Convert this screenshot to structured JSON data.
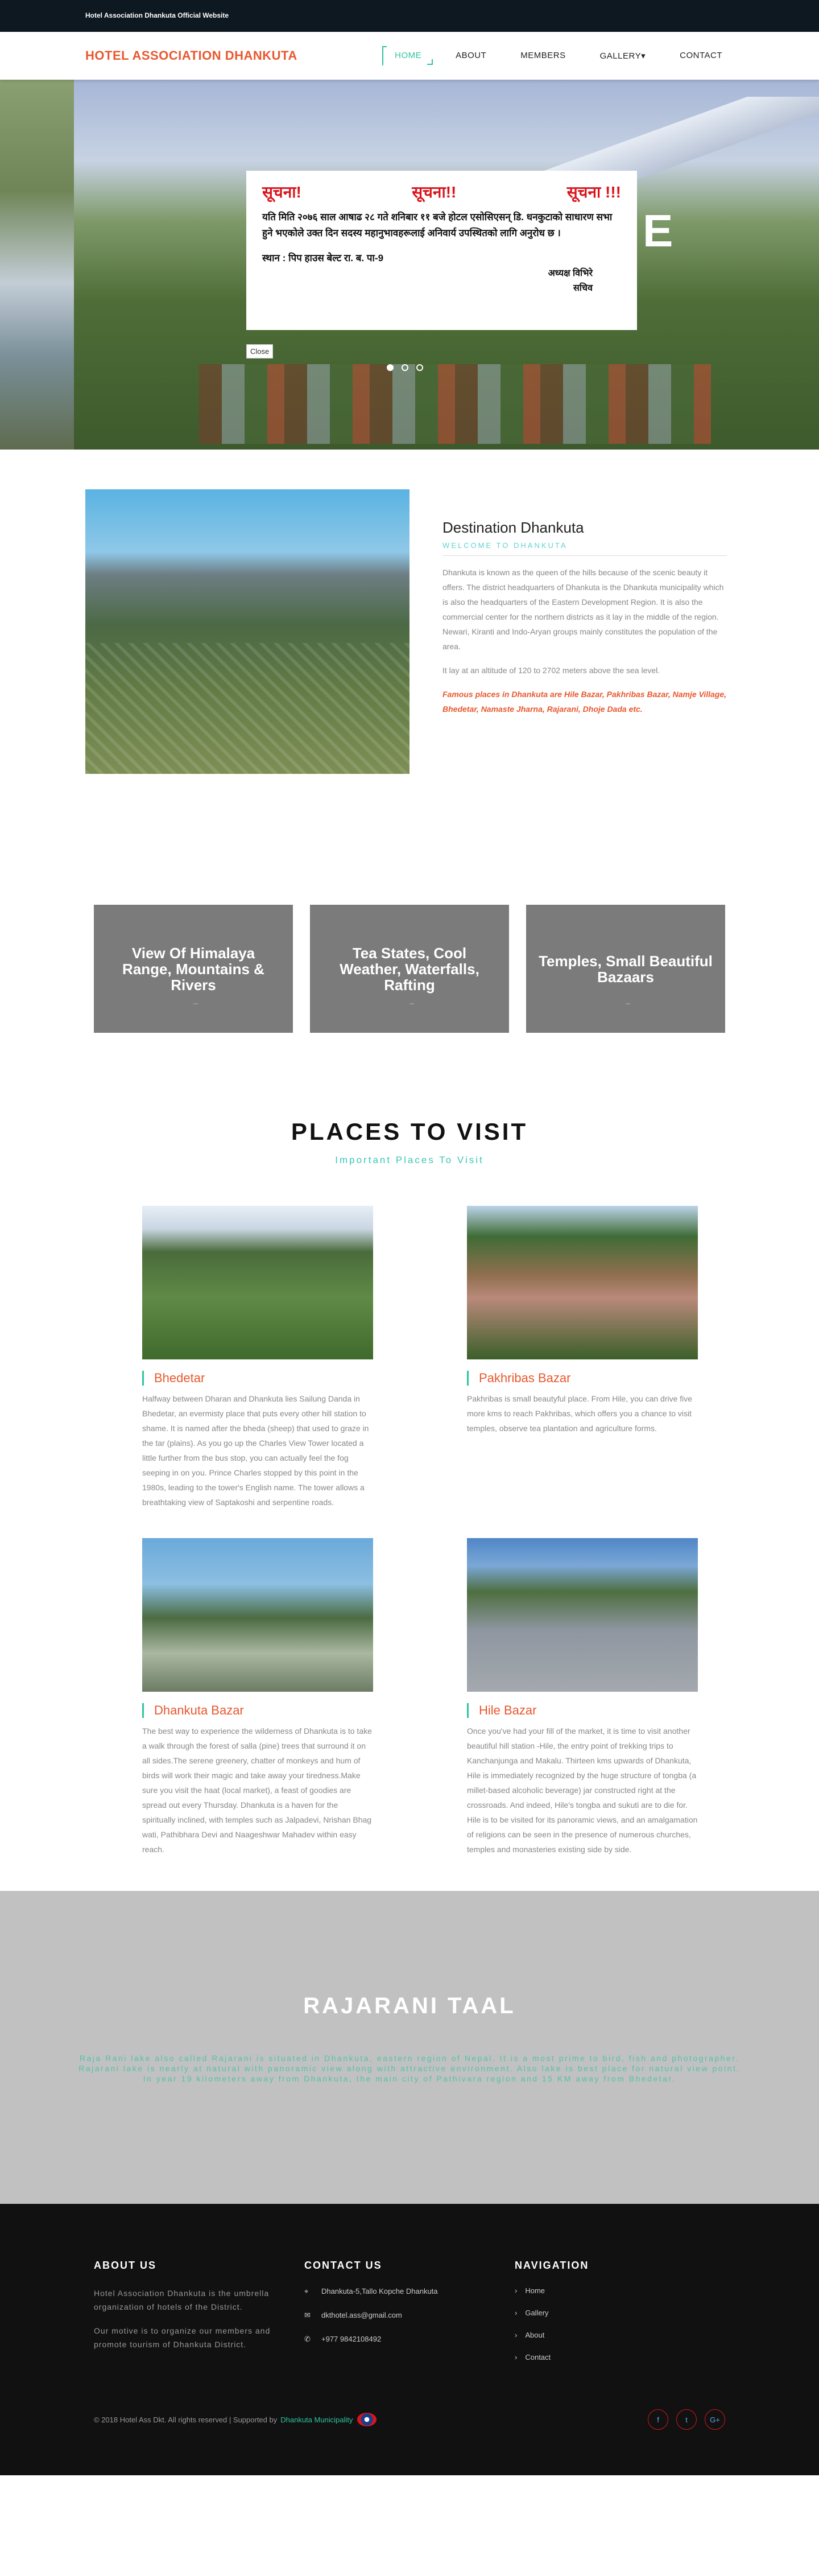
{
  "topbar": {
    "text": "Hotel Association Dhankuta Official Website"
  },
  "brand": "HOTEL ASSOCIATION DHANKUTA",
  "menu": [
    {
      "label": "HOME"
    },
    {
      "label": "ABOUT"
    },
    {
      "label": "MEMBERS"
    },
    {
      "label": "GALLERY▾"
    },
    {
      "label": "CONTACT"
    }
  ],
  "notice": {
    "head1": "सूचना!",
    "head2": "सूचना!!",
    "head3": "सूचना !!!",
    "body": "यति मिति २०७६ साल आषाढ २८ गते शनिबार ११ बजे होटल एसोसिएसन् डि. धनकुटाको साधारण सभा हुने भएकोले उक्त दिन सदस्य महानुभावहरूलाई अनिवार्य उपस्थितको लागि अनुरोध छ ।",
    "venue": "स्थान : पिप हाउस बेल्ट रा. ब. पा-9",
    "sign1": "अध्यक्ष विभिरे",
    "sign2": "सचिव",
    "close": "Close",
    "hero_letter": "E"
  },
  "destination": {
    "title": "Destination Dhankuta",
    "subtitle": "WELCOME TO DHANKUTA",
    "p1": "Dhankuta is known as the queen of the hills because of the scenic beauty it offers. The district headquarters of Dhankuta is the Dhankuta municipality which is also the headquarters of the Eastern Development Region. It is also the commercial center for the northern districts as it lay in the middle of the region. Newari, Kiranti and Indo-Aryan groups mainly constitutes the population of the area.",
    "p2": "It lay at an altitude of 120 to 2702 meters above the sea level.",
    "p3": "Famous places in Dhankuta are Hile Bazar, Pakhribas Bazar, Namje Village, Bhedetar, Namaste Jharna, Rajarani, Dhoje Dada etc."
  },
  "features": [
    {
      "title": "View Of Himalaya Range, Mountains & Rivers"
    },
    {
      "title": "Tea States, Cool Weather, Waterfalls, Rafting"
    },
    {
      "title": "Temples, Small Beautiful Bazaars"
    }
  ],
  "places": {
    "title": "PLACES TO VISIT",
    "subtitle": "Important Places To Visit",
    "items": [
      {
        "name": "Bhedetar",
        "text": "Halfway between Dharan and Dhankuta lies Sailung Danda in Bhedetar, an evermisty place that puts every other hill station to shame. It is named after the bheda (sheep) that used to graze in the tar (plains). As you go up the Charles View Tower located a little further from the bus stop, you can actually feel the fog seeping in on you. Prince Charles stopped by this point in the 1980s, leading to the tower's English name. The tower allows a breathtaking view of Saptakoshi and serpentine roads."
      },
      {
        "name": "Pakhribas Bazar",
        "text": "Pakhribas is small beautyful place. From Hile, you can drive five more kms to reach Pakhribas, which offers you a chance to visit temples, observe tea plantation and agriculture forms."
      },
      {
        "name": "Dhankuta Bazar",
        "text": "The best way to experience the wilderness of Dhankuta is to take a walk through the forest of salla (pine) trees that surround it on all sides.The serene greenery, chatter of monkeys and hum of birds will work their magic and take away your tiredness.Make sure you visit the haat (local market), a feast of goodies are spread out every Thursday. Dhankuta is a haven for the spiritually inclined, with temples such as Jalpadevi, Nrishan Bhag wati, Pathibhara Devi and Naageshwar Mahadev within easy reach."
      },
      {
        "name": "Hile Bazar",
        "text": "Once you've had your fill of the market, it is time to visit another beautiful hill station -Hile, the entry point of trekking trips to Kanchanjunga and Makalu. Thirteen kms upwards of Dhankuta, Hile is immediately recognized by the huge structure of tongba (a millet-based alcoholic beverage) jar constructed right at the crossroads. And indeed, Hile's tongba and sukuti are to die for. Hile is to be visited for its panoramic views, and an amalgamation of religions can be seen in the presence of numerous churches, temples and monasteries existing side by side."
      }
    ]
  },
  "taal": {
    "title": "RAJARANI TAAL",
    "text": "Raja Rani lake also called Rajarani is situated in Dhankuta, eastern region of Nepal. It is a most prime to bird, fish and photographer. Rajarani lake is nearly at natural with panoramic view along with attractive environment. Also lake is best place for natural view point. In year 19 kilometers away from Dhankuta, the main city of Pathivara region and 15 KM away from Bhedetar."
  },
  "footer": {
    "about_title": "ABOUT US",
    "about_p1": "Hotel Association Dhankuta is the umbrella organization of hotels of the District.",
    "about_p2": "Our motive is to organize our members and promote tourism of Dhankuta District.",
    "contact_title": "CONTACT US",
    "address": "Dhankuta-5,Tallo Kopche Dhankuta",
    "email": "dkthotel.ass@gmail.com",
    "phone": "+977 9842108492",
    "nav_title": "NAVIGATION",
    "nav": [
      "Home",
      "Gallery",
      "About",
      "Contact"
    ],
    "copyright": "© 2018 Hotel Ass Dkt. All rights reserved | Supported by",
    "supported_link": "Dhankuta Municipality",
    "social": [
      "f",
      "t",
      "G+"
    ]
  }
}
